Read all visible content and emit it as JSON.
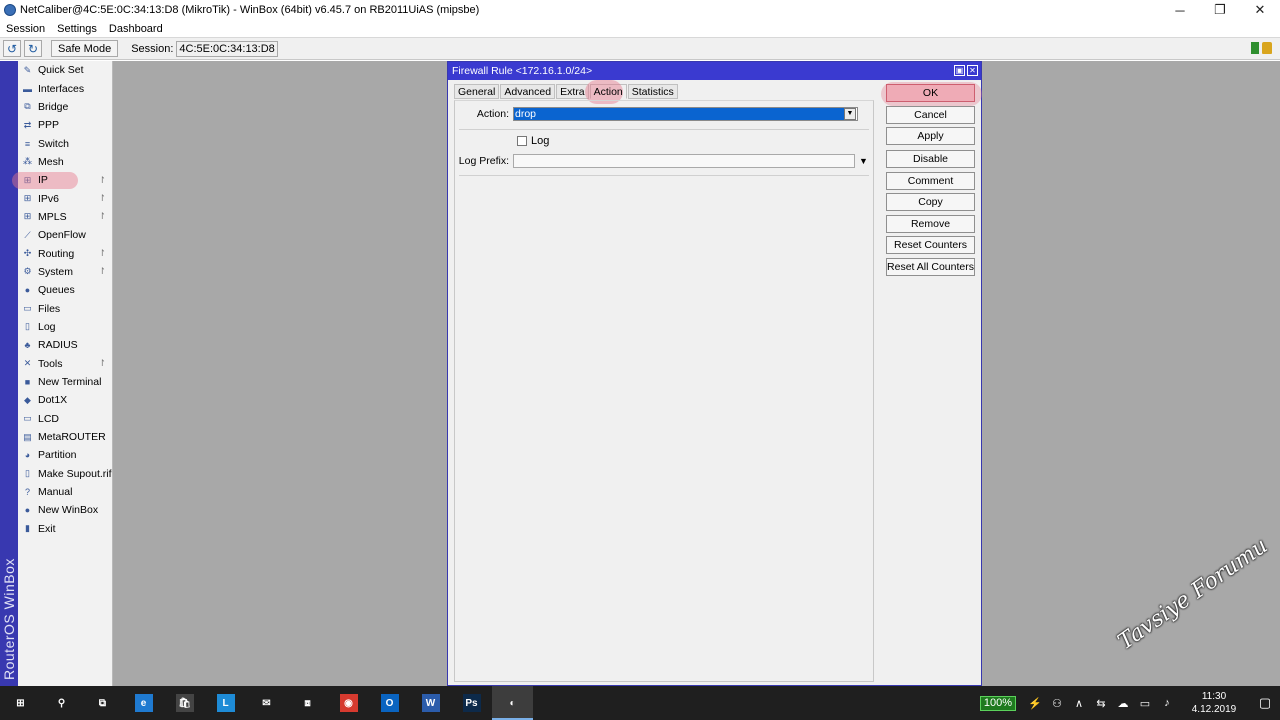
{
  "window": {
    "title": "NetCaliber@4C:5E:0C:34:13:D8 (MikroTik) - WinBox (64bit) v6.45.7 on RB2011UiAS (mipsbe)",
    "minimize": "─",
    "maximize": "❐",
    "close": "✕"
  },
  "menu": [
    "Session",
    "Settings",
    "Dashboard"
  ],
  "toolbar": {
    "undo_icon": "undo-icon",
    "redo_icon": "redo-icon",
    "safe_mode": "Safe Mode",
    "session_label": "Session:",
    "session_value": "4C:5E:0C:34:13:D8"
  },
  "brand": "RouterOS WinBox",
  "sidebar": {
    "items": [
      {
        "label": "Quick Set",
        "icon": "quick-set-icon",
        "glyph": "✎",
        "submenu": false
      },
      {
        "label": "Interfaces",
        "icon": "interfaces-icon",
        "glyph": "▬",
        "submenu": false
      },
      {
        "label": "Bridge",
        "icon": "bridge-icon",
        "glyph": "⧉",
        "submenu": false
      },
      {
        "label": "PPP",
        "icon": "ppp-icon",
        "glyph": "⇄",
        "submenu": false
      },
      {
        "label": "Switch",
        "icon": "switch-icon",
        "glyph": "≡",
        "submenu": false
      },
      {
        "label": "Mesh",
        "icon": "mesh-icon",
        "glyph": "⁂",
        "submenu": false
      },
      {
        "label": "IP",
        "icon": "ip-icon",
        "glyph": "⊞",
        "submenu": true
      },
      {
        "label": "IPv6",
        "icon": "ipv6-icon",
        "glyph": "⊞",
        "submenu": true
      },
      {
        "label": "MPLS",
        "icon": "mpls-icon",
        "glyph": "⊞",
        "submenu": true
      },
      {
        "label": "OpenFlow",
        "icon": "openflow-icon",
        "glyph": "⟋",
        "submenu": false
      },
      {
        "label": "Routing",
        "icon": "routing-icon",
        "glyph": "✣",
        "submenu": true
      },
      {
        "label": "System",
        "icon": "system-icon",
        "glyph": "⚙",
        "submenu": true
      },
      {
        "label": "Queues",
        "icon": "queues-icon",
        "glyph": "●",
        "submenu": false
      },
      {
        "label": "Files",
        "icon": "files-icon",
        "glyph": "▭",
        "submenu": false
      },
      {
        "label": "Log",
        "icon": "log-icon",
        "glyph": "▯",
        "submenu": false
      },
      {
        "label": "RADIUS",
        "icon": "radius-icon",
        "glyph": "♣",
        "submenu": false
      },
      {
        "label": "Tools",
        "icon": "tools-icon",
        "glyph": "✕",
        "submenu": true
      },
      {
        "label": "New Terminal",
        "icon": "terminal-icon",
        "glyph": "■",
        "submenu": false
      },
      {
        "label": "Dot1X",
        "icon": "dot1x-icon",
        "glyph": "◆",
        "submenu": false
      },
      {
        "label": "LCD",
        "icon": "lcd-icon",
        "glyph": "▭",
        "submenu": false
      },
      {
        "label": "MetaROUTER",
        "icon": "metarouter-icon",
        "glyph": "▤",
        "submenu": false
      },
      {
        "label": "Partition",
        "icon": "partition-icon",
        "glyph": "◕",
        "submenu": false
      },
      {
        "label": "Make Supout.rif",
        "icon": "supout-icon",
        "glyph": "▯",
        "submenu": false
      },
      {
        "label": "Manual",
        "icon": "manual-icon",
        "glyph": "?",
        "submenu": false
      },
      {
        "label": "New WinBox",
        "icon": "winbox-icon",
        "glyph": "●",
        "submenu": false
      },
      {
        "label": "Exit",
        "icon": "exit-icon",
        "glyph": "▮",
        "submenu": false
      }
    ]
  },
  "dialog": {
    "title": "Firewall Rule <172.16.1.0/24>",
    "tabs": [
      "General",
      "Advanced",
      "Extra",
      "Action",
      "Statistics"
    ],
    "active_tab": "Action",
    "fields": {
      "action_label": "Action:",
      "action_value": "drop",
      "log_label": "Log",
      "log_checked": false,
      "log_prefix_label": "Log Prefix:",
      "log_prefix_value": ""
    },
    "buttons": [
      "OK",
      "Cancel",
      "Apply",
      "Disable",
      "Comment",
      "Copy",
      "Remove",
      "Reset Counters",
      "Reset All Counters"
    ]
  },
  "taskbar": {
    "apps": [
      {
        "name": "start-button",
        "glyph": "⊞"
      },
      {
        "name": "search-icon",
        "glyph": "⚲"
      },
      {
        "name": "task-view-icon",
        "glyph": "⧉"
      },
      {
        "name": "edge-icon",
        "glyph": "e"
      },
      {
        "name": "store-icon",
        "glyph": "🛍"
      },
      {
        "name": "l-app-icon",
        "glyph": "L"
      },
      {
        "name": "mail-icon",
        "glyph": "✉"
      },
      {
        "name": "app-icon",
        "glyph": "⧈"
      },
      {
        "name": "chrome-icon",
        "glyph": "◉"
      },
      {
        "name": "outlook-icon",
        "glyph": "O"
      },
      {
        "name": "word-icon",
        "glyph": "W"
      },
      {
        "name": "photoshop-icon",
        "glyph": "Ps"
      },
      {
        "name": "winbox-taskbar-icon",
        "glyph": "◐"
      }
    ],
    "battery": "100%",
    "time": "11:30",
    "date": "4.12.2019",
    "watermark": "Tavsiye Forumu"
  }
}
